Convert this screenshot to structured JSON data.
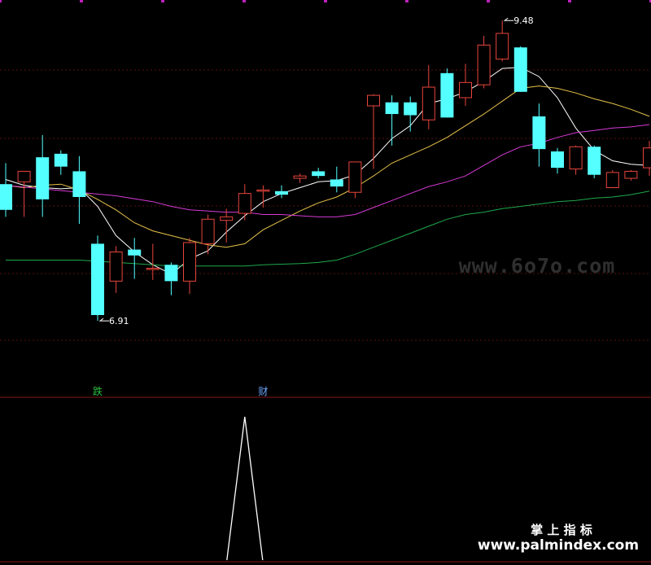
{
  "chart_data": {
    "type": "candlestick",
    "y_range": [
      6.5,
      9.6
    ],
    "candles": [
      {
        "o": 8.08,
        "h": 8.26,
        "l": 7.8,
        "c": 7.86
      },
      {
        "o": 8.1,
        "h": 8.16,
        "l": 7.8,
        "c": 8.19
      },
      {
        "o": 8.31,
        "h": 8.5,
        "l": 7.8,
        "c": 7.95
      },
      {
        "o": 8.34,
        "h": 8.37,
        "l": 8.16,
        "c": 8.23
      },
      {
        "o": 8.19,
        "h": 8.32,
        "l": 7.74,
        "c": 7.97
      },
      {
        "o": 7.57,
        "h": 7.64,
        "l": 6.91,
        "c": 6.96
      },
      {
        "o": 7.25,
        "h": 7.55,
        "l": 7.15,
        "c": 7.5
      },
      {
        "o": 7.52,
        "h": 7.62,
        "l": 7.27,
        "c": 7.47
      },
      {
        "o": 7.36,
        "h": 7.57,
        "l": 7.26,
        "c": 7.36
      },
      {
        "o": 7.39,
        "h": 7.41,
        "l": 7.13,
        "c": 7.25
      },
      {
        "o": 7.25,
        "h": 7.62,
        "l": 7.14,
        "c": 7.58
      },
      {
        "o": 7.57,
        "h": 7.82,
        "l": 7.48,
        "c": 7.78
      },
      {
        "o": 7.77,
        "h": 7.87,
        "l": 7.58,
        "c": 7.8
      },
      {
        "o": 7.83,
        "h": 8.08,
        "l": 7.77,
        "c": 8.0
      },
      {
        "o": 8.03,
        "h": 8.07,
        "l": 7.88,
        "c": 8.03
      },
      {
        "o": 8.02,
        "h": 8.07,
        "l": 7.96,
        "c": 7.99
      },
      {
        "o": 8.13,
        "h": 8.17,
        "l": 8.09,
        "c": 8.15
      },
      {
        "o": 8.19,
        "h": 8.22,
        "l": 8.13,
        "c": 8.15
      },
      {
        "o": 8.12,
        "h": 8.23,
        "l": 8.01,
        "c": 8.06
      },
      {
        "o": 8.01,
        "h": 8.27,
        "l": 7.96,
        "c": 8.27
      },
      {
        "o": 8.75,
        "h": 8.85,
        "l": 8.21,
        "c": 8.84
      },
      {
        "o": 8.78,
        "h": 8.84,
        "l": 8.41,
        "c": 8.68
      },
      {
        "o": 8.78,
        "h": 8.83,
        "l": 8.53,
        "c": 8.67
      },
      {
        "o": 8.63,
        "h": 9.1,
        "l": 8.55,
        "c": 8.91
      },
      {
        "o": 9.03,
        "h": 9.07,
        "l": 8.65,
        "c": 8.65
      },
      {
        "o": 8.82,
        "h": 9.11,
        "l": 8.75,
        "c": 8.95
      },
      {
        "o": 8.93,
        "h": 9.35,
        "l": 8.9,
        "c": 9.27
      },
      {
        "o": 9.15,
        "h": 9.48,
        "l": 9.13,
        "c": 9.37
      },
      {
        "o": 9.25,
        "h": 9.26,
        "l": 8.87,
        "c": 8.87
      },
      {
        "o": 8.66,
        "h": 8.77,
        "l": 8.23,
        "c": 8.38
      },
      {
        "o": 8.36,
        "h": 8.39,
        "l": 8.17,
        "c": 8.22
      },
      {
        "o": 8.21,
        "h": 8.41,
        "l": 8.16,
        "c": 8.4
      },
      {
        "o": 8.4,
        "h": 8.41,
        "l": 8.13,
        "c": 8.16
      },
      {
        "o": 8.05,
        "h": 8.2,
        "l": 8.05,
        "c": 8.18
      },
      {
        "o": 8.13,
        "h": 8.2,
        "l": 8.11,
        "c": 8.19
      },
      {
        "o": 8.22,
        "h": 8.45,
        "l": 8.15,
        "c": 8.39
      }
    ],
    "ma_series": [
      {
        "color": "#ffffff",
        "points": [
          [
            0,
            8.12
          ],
          [
            1,
            8.07
          ],
          [
            2,
            8.05
          ],
          [
            3,
            8.04
          ],
          [
            4,
            8.05
          ],
          [
            5,
            7.89
          ],
          [
            6,
            7.64
          ],
          [
            7,
            7.5
          ],
          [
            8,
            7.39
          ],
          [
            9,
            7.31
          ],
          [
            10,
            7.44
          ],
          [
            11,
            7.51
          ],
          [
            12,
            7.67
          ],
          [
            13,
            7.81
          ],
          [
            14,
            7.93
          ],
          [
            15,
            8.0
          ],
          [
            16,
            8.05
          ],
          [
            17,
            8.1
          ],
          [
            18,
            8.11
          ],
          [
            19,
            8.16
          ],
          [
            20,
            8.3
          ],
          [
            21,
            8.47
          ],
          [
            22,
            8.58
          ],
          [
            23,
            8.77
          ],
          [
            24,
            8.81
          ],
          [
            25,
            8.87
          ],
          [
            26,
            8.96
          ],
          [
            27,
            9.07
          ],
          [
            28,
            9.08
          ],
          [
            29,
            9.0
          ],
          [
            30,
            8.82
          ],
          [
            31,
            8.56
          ],
          [
            32,
            8.37
          ],
          [
            33,
            8.28
          ],
          [
            34,
            8.25
          ],
          [
            35,
            8.24
          ]
        ]
      },
      {
        "color": "#e6c24a",
        "points": [
          [
            0,
            8.07
          ],
          [
            1,
            8.05
          ],
          [
            2,
            8.07
          ],
          [
            3,
            8.08
          ],
          [
            4,
            8.03
          ],
          [
            5,
            7.95
          ],
          [
            6,
            7.86
          ],
          [
            7,
            7.75
          ],
          [
            8,
            7.68
          ],
          [
            9,
            7.64
          ],
          [
            10,
            7.6
          ],
          [
            11,
            7.56
          ],
          [
            12,
            7.54
          ],
          [
            13,
            7.57
          ],
          [
            14,
            7.69
          ],
          [
            15,
            7.77
          ],
          [
            16,
            7.85
          ],
          [
            17,
            7.92
          ],
          [
            18,
            7.97
          ],
          [
            19,
            8.05
          ],
          [
            20,
            8.15
          ],
          [
            21,
            8.26
          ],
          [
            22,
            8.33
          ],
          [
            23,
            8.4
          ],
          [
            24,
            8.48
          ],
          [
            25,
            8.58
          ],
          [
            26,
            8.68
          ],
          [
            27,
            8.79
          ],
          [
            28,
            8.9
          ],
          [
            29,
            8.92
          ],
          [
            30,
            8.9
          ],
          [
            31,
            8.86
          ],
          [
            32,
            8.81
          ],
          [
            33,
            8.77
          ],
          [
            34,
            8.72
          ],
          [
            35,
            8.66
          ]
        ]
      },
      {
        "color": "#d63ad6",
        "points": [
          [
            0,
            8.07
          ],
          [
            4,
            8.01
          ],
          [
            6,
            7.98
          ],
          [
            8,
            7.93
          ],
          [
            9,
            7.89
          ],
          [
            10,
            7.86
          ],
          [
            11,
            7.85
          ],
          [
            12,
            7.84
          ],
          [
            13,
            7.84
          ],
          [
            14,
            7.82
          ],
          [
            15,
            7.82
          ],
          [
            16,
            7.81
          ],
          [
            17,
            7.8
          ],
          [
            18,
            7.8
          ],
          [
            19,
            7.82
          ],
          [
            20,
            7.88
          ],
          [
            21,
            7.94
          ],
          [
            22,
            8.0
          ],
          [
            23,
            8.06
          ],
          [
            24,
            8.1
          ],
          [
            25,
            8.15
          ],
          [
            26,
            8.24
          ],
          [
            27,
            8.33
          ],
          [
            28,
            8.4
          ],
          [
            29,
            8.43
          ],
          [
            30,
            8.48
          ],
          [
            31,
            8.52
          ],
          [
            32,
            8.54
          ],
          [
            33,
            8.56
          ],
          [
            34,
            8.57
          ],
          [
            35,
            8.59
          ]
        ]
      },
      {
        "color": "#1fa84a",
        "points": [
          [
            0,
            7.43
          ],
          [
            2,
            7.43
          ],
          [
            4,
            7.43
          ],
          [
            5,
            7.42
          ],
          [
            7,
            7.4
          ],
          [
            9,
            7.38
          ],
          [
            11,
            7.38
          ],
          [
            13,
            7.38
          ],
          [
            14,
            7.39
          ],
          [
            16,
            7.4
          ],
          [
            17,
            7.41
          ],
          [
            18,
            7.43
          ],
          [
            19,
            7.48
          ],
          [
            20,
            7.54
          ],
          [
            21,
            7.6
          ],
          [
            22,
            7.66
          ],
          [
            23,
            7.72
          ],
          [
            24,
            7.78
          ],
          [
            25,
            7.82
          ],
          [
            26,
            7.84
          ],
          [
            27,
            7.87
          ],
          [
            28,
            7.89
          ],
          [
            29,
            7.91
          ],
          [
            30,
            7.93
          ],
          [
            31,
            7.94
          ],
          [
            32,
            7.96
          ],
          [
            33,
            7.97
          ],
          [
            34,
            7.99
          ],
          [
            35,
            8.02
          ]
        ]
      }
    ],
    "annotations": [
      {
        "index": 5,
        "value": 6.91,
        "text": "6.91"
      },
      {
        "index": 27,
        "value": 9.48,
        "text": "9.48"
      }
    ],
    "signals": [
      {
        "index": 5,
        "text": "跌",
        "color": "#28c040"
      },
      {
        "index": 14,
        "text": "财",
        "color": "#6fa8ff"
      }
    ],
    "indicator": {
      "peak_index": 13,
      "peak_value": 1,
      "baseline": 0
    }
  },
  "watermarks": {
    "center": "www.6o7o.com",
    "bottom_title": "掌 上 指 标",
    "bottom_url": "www.palmindex.com"
  }
}
